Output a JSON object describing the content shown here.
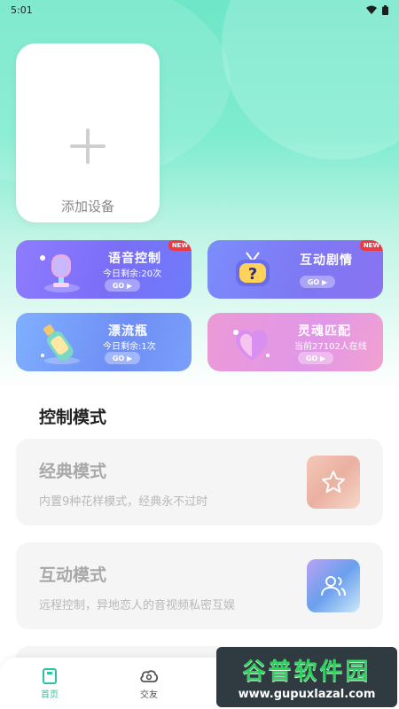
{
  "status_bar": {
    "time": "5:01"
  },
  "add_device": {
    "label": "添加设备"
  },
  "features": [
    {
      "title": "语音控制",
      "subtitle": "今日剩余:20次",
      "go": "GO ▶",
      "badge": "NEW"
    },
    {
      "title": "互动剧情",
      "subtitle": "",
      "go": "GO ▶",
      "badge": "NEW"
    },
    {
      "title": "漂流瓶",
      "subtitle": "今日剩余:1次",
      "go": "GO ▶"
    },
    {
      "title": "灵魂匹配",
      "subtitle": "当前27102人在线",
      "go": "GO ▶"
    }
  ],
  "control": {
    "section_title": "控制模式",
    "modes": [
      {
        "name": "经典模式",
        "desc": "内置9种花样模式，经典永不过时",
        "icon": "star-icon"
      },
      {
        "name": "互动模式",
        "desc": "远程控制，异地恋人的音视频私密互娱",
        "icon": "users-icon"
      }
    ]
  },
  "tabs": [
    {
      "label": "首页",
      "icon": "home-icon",
      "active": true
    },
    {
      "label": "交友",
      "icon": "chat-cloud-icon",
      "active": false
    }
  ],
  "watermark": {
    "cn": "谷普软件园",
    "url": "www.gupuxlazal.com"
  },
  "colors": {
    "accent": "#2ac59e",
    "new_badge": "#e93b44"
  }
}
